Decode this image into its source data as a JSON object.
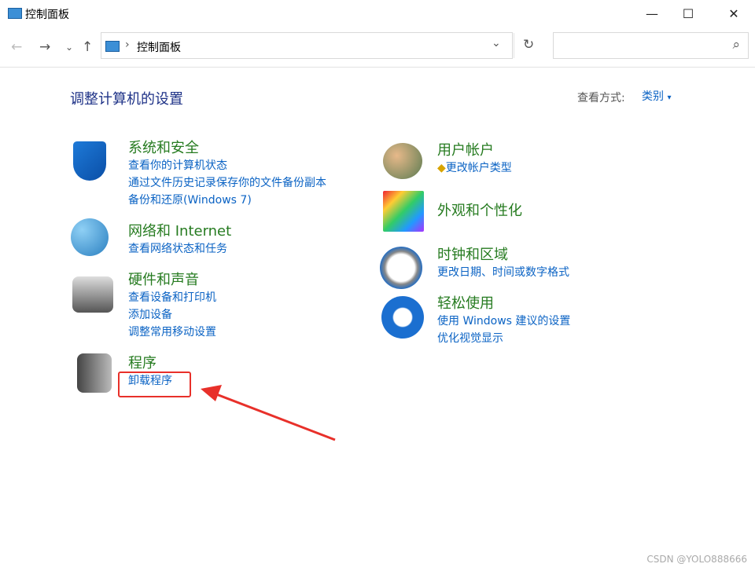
{
  "window": {
    "title": "控制面板",
    "minimize": "—",
    "maximize": "☐",
    "close": "✕"
  },
  "nav": {
    "back": "←",
    "forward": "→",
    "recent": "⌄",
    "up": "↑",
    "breadcrumb_sep": "›",
    "breadcrumb": "控制面板",
    "dropdown": "⌄",
    "refresh": "↻",
    "search_placeholder": "",
    "search_icon": "⌕"
  },
  "main": {
    "heading": "调整计算机的设置",
    "view_label": "查看方式:",
    "view_value": "类别",
    "view_caret": "▾"
  },
  "categories": [
    {
      "title": "系统和安全",
      "links": [
        "查看你的计算机状态",
        "通过文件历史记录保存你的文件备份副本",
        "备份和还原(Windows 7)"
      ]
    },
    {
      "title": "网络和 Internet",
      "links": [
        "查看网络状态和任务"
      ]
    },
    {
      "title": "硬件和声音",
      "links": [
        "查看设备和打印机",
        "添加设备",
        "调整常用移动设置"
      ]
    },
    {
      "title": "程序",
      "links": [
        "卸载程序"
      ]
    },
    {
      "title": "用户帐户",
      "links": [
        "更改帐户类型"
      ]
    },
    {
      "title": "外观和个性化",
      "links": []
    },
    {
      "title": "时钟和区域",
      "links": [
        "更改日期、时间或数字格式"
      ]
    },
    {
      "title": "轻松使用",
      "links": [
        "使用 Windows 建议的设置",
        "优化视觉显示"
      ]
    }
  ],
  "watermark": "CSDN @YOLO888666",
  "colors": {
    "category": "#267b20",
    "link": "#0b63c4",
    "highlight": "#e8302a"
  }
}
